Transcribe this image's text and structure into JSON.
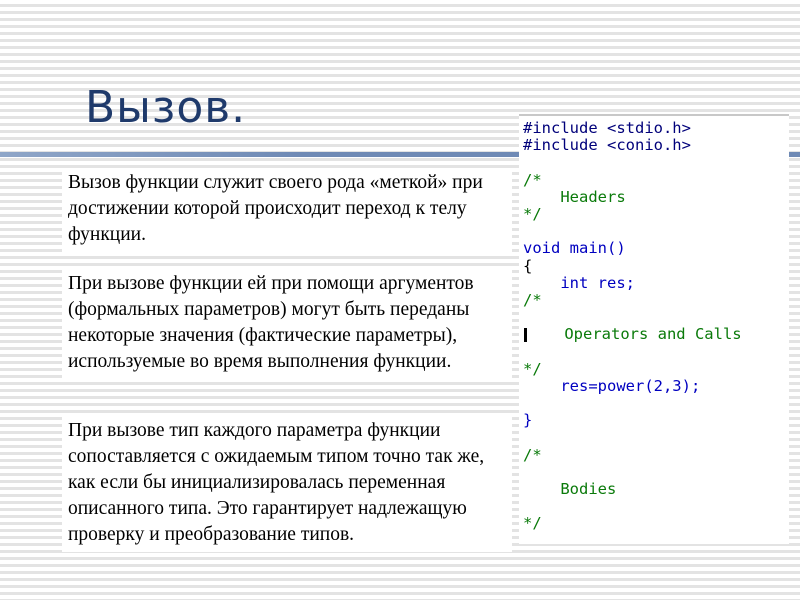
{
  "title": "Вызов.",
  "paragraphs": [
    "Вызов функции служит своего рода «меткой» при достижении которой происходит переход к телу функции.",
    "При вызове функции ей при помощи аргументов (формальных параметров) могут быть переданы некоторые значения (фактические параметры), используемые во время выполнения функции.",
    "При вызове тип каждого параметра функции сопоставляется с ожидаемым типом точно так же, как если бы инициализировалась переменная описанного типа. Это гарантирует надлежащую проверку и преобразование типов."
  ],
  "code": {
    "include_stdio": "#include <stdio.h>",
    "include_conio": "#include <conio.h>",
    "comment_open_1": "/*",
    "headers": "    Headers",
    "comment_close_1": "*/",
    "main_sig": "void main()",
    "brace_open": "{",
    "int_res": "    int res;",
    "comment_open_2": "/*",
    "operators_calls": "    Operators and Calls",
    "comment_close_2": "*/",
    "res_power": "    res=power(2,3);",
    "brace_close": "}",
    "comment_open_3": "/*",
    "bodies": "    Bodies",
    "comment_close_3": "*/"
  },
  "colors": {
    "title": "#1f3a6b",
    "keyword": "#0000c0",
    "comment": "#0a7a0a",
    "rule": "#6f8ab5"
  }
}
